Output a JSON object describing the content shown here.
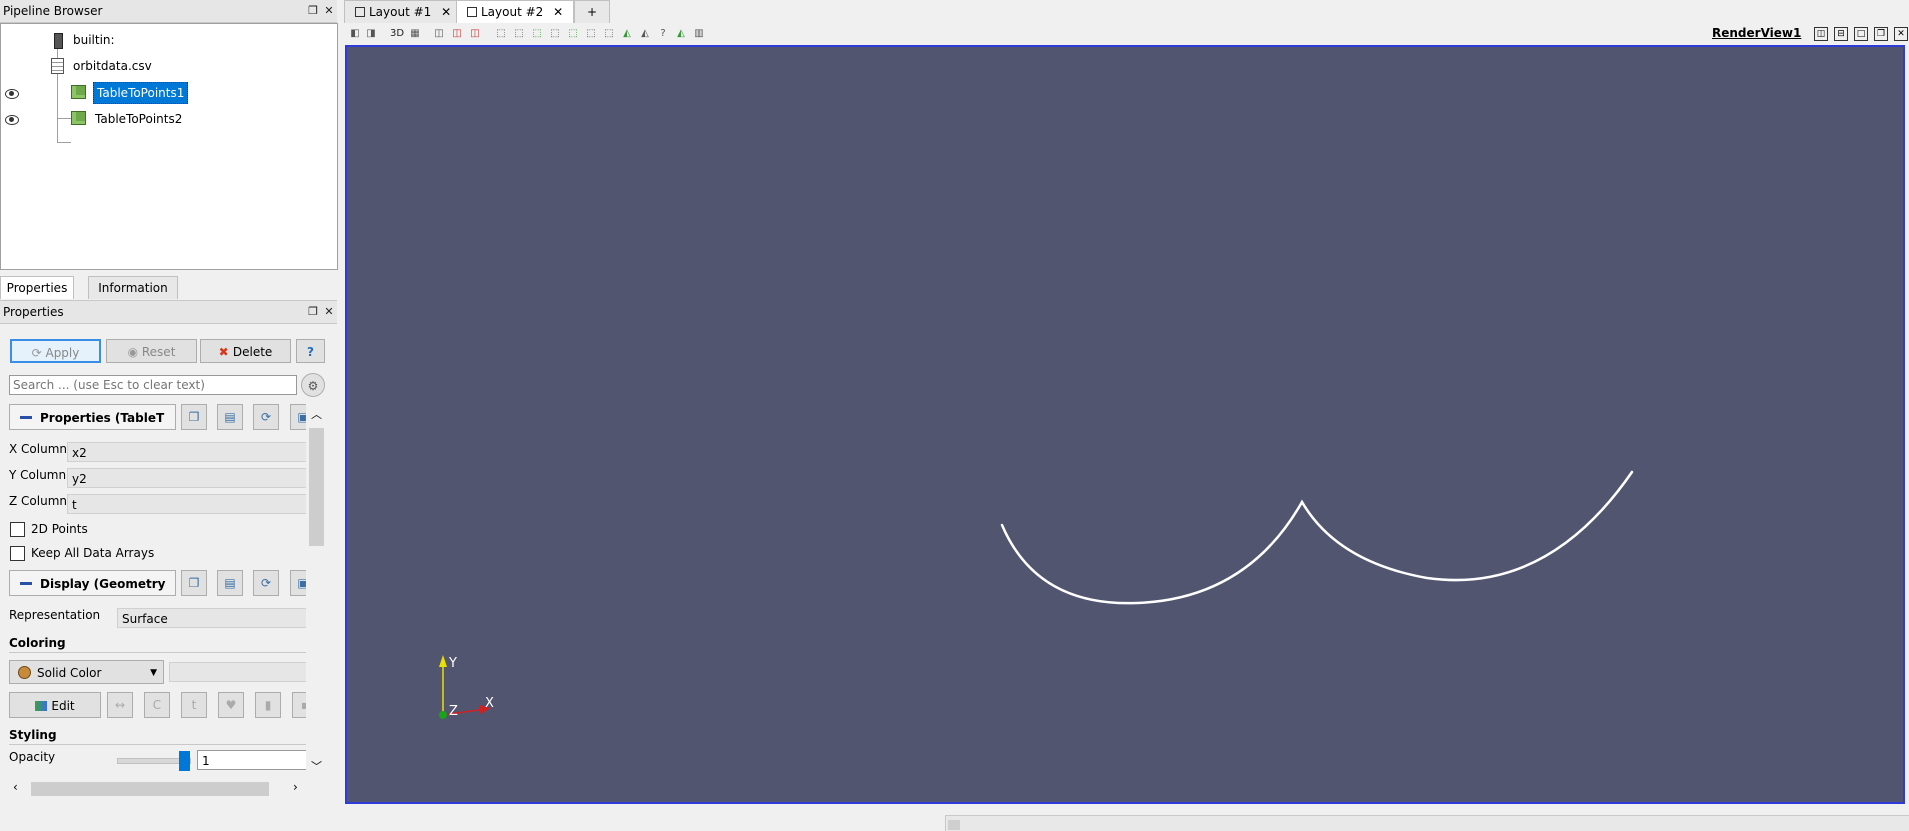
{
  "pipeline": {
    "title": "Pipeline Browser",
    "items": [
      {
        "label": "builtin:"
      },
      {
        "label": "orbitdata.csv"
      },
      {
        "label": "TableToPoints1"
      },
      {
        "label": "TableToPoints2"
      }
    ]
  },
  "prop_tabs": {
    "properties": "Properties",
    "information": "Information"
  },
  "properties": {
    "title": "Properties",
    "apply": "Apply",
    "reset": "Reset",
    "delete": "Delete",
    "help": "?",
    "search_placeholder": "Search ... (use Esc to clear text)",
    "section_props": "Properties (TableT",
    "x_column_label": "X Column",
    "x_column_value": "x2",
    "y_column_label": "Y Column",
    "y_column_value": "y2",
    "z_column_label": "Z Column",
    "z_column_value": "t",
    "points2d": "2D Points",
    "keep_arrays": "Keep All Data Arrays",
    "section_display": "Display (Geometry",
    "representation_label": "Representation",
    "representation_value": "Surface",
    "coloring_title": "Coloring",
    "coloring_value": "Solid Color",
    "edit": "Edit",
    "styling_title": "Styling",
    "opacity_label": "Opacity",
    "opacity_value": "1",
    "opacity_fraction": 1.0
  },
  "layout_tabs": [
    {
      "label": "Layout #1"
    },
    {
      "label": "Layout #2"
    },
    {
      "label": "+"
    }
  ],
  "view": {
    "toolbar_3d": "3D",
    "render_view": "RenderView1",
    "background": "#525570",
    "axes": {
      "y": "Y",
      "z": "Z",
      "x": "X"
    }
  }
}
